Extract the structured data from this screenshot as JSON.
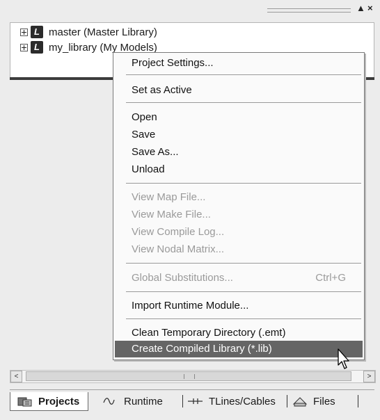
{
  "pane": {
    "pin_glyph": "▲",
    "close_glyph": "×"
  },
  "tree": {
    "items": [
      {
        "label": "master (Master Library)"
      },
      {
        "label": "my_library (My Models)"
      }
    ]
  },
  "context_menu": {
    "items": [
      {
        "label": "Project Settings...",
        "enabled": true
      },
      {
        "label": "Set as Active",
        "enabled": true
      },
      {
        "label": "Open",
        "enabled": true
      },
      {
        "label": "Save",
        "enabled": true
      },
      {
        "label": "Save As...",
        "enabled": true
      },
      {
        "label": "Unload",
        "enabled": true
      },
      {
        "label": "View Map File...",
        "enabled": false
      },
      {
        "label": "View Make File...",
        "enabled": false
      },
      {
        "label": "View Compile Log...",
        "enabled": false
      },
      {
        "label": "View Nodal Matrix...",
        "enabled": false
      },
      {
        "label": "Global Substitutions...",
        "enabled": false,
        "shortcut": "Ctrl+G"
      },
      {
        "label": "Import Runtime Module...",
        "enabled": true
      },
      {
        "label": "Clean Temporary Directory (.emt)",
        "enabled": true
      },
      {
        "label": "Create Compiled Library (*.lib)",
        "enabled": true,
        "highlighted": true
      }
    ]
  },
  "scrollbar": {
    "left_glyph": "<",
    "right_glyph": ">"
  },
  "tabs": [
    {
      "label": "Projects",
      "icon": "projects-icon",
      "active": true
    },
    {
      "label": "Runtime",
      "icon": "runtime-icon",
      "active": false
    },
    {
      "label": "TLines/Cables",
      "icon": "tlines-icon",
      "active": false
    },
    {
      "label": "Files",
      "icon": "files-icon",
      "active": false
    }
  ]
}
